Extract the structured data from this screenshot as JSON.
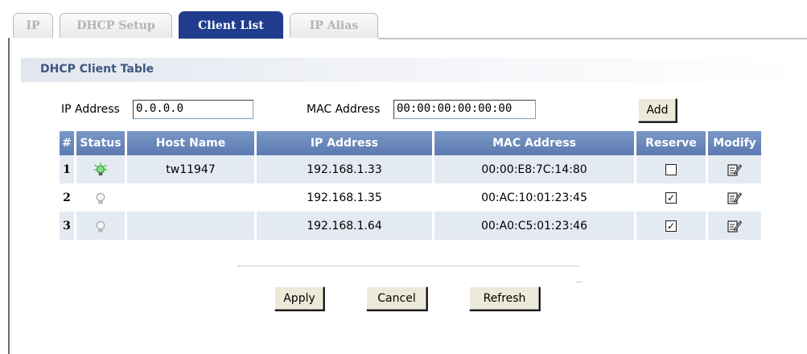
{
  "tabs": [
    {
      "label": "IP",
      "active": false
    },
    {
      "label": "DHCP Setup",
      "active": false
    },
    {
      "label": "Client List",
      "active": true
    },
    {
      "label": "IP Alias",
      "active": false
    }
  ],
  "section": {
    "title": "DHCP Client Table"
  },
  "add_form": {
    "ip_label": "IP Address",
    "ip_value": "0.0.0.0",
    "mac_label": "MAC Address",
    "mac_value": "00:00:00:00:00:00",
    "add_label": "Add"
  },
  "table": {
    "headers": [
      "#",
      "Status",
      "Host Name",
      "IP Address",
      "MAC Address",
      "Reserve",
      "Modify"
    ],
    "rows": [
      {
        "num": "1",
        "status": "active",
        "host": "tw11947",
        "ip": "192.168.1.33",
        "mac": "00:00:E8:7C:14:80",
        "reserve": false
      },
      {
        "num": "2",
        "status": "inactive",
        "host": "",
        "ip": "192.168.1.35",
        "mac": "00:AC:10:01:23:45",
        "reserve": true
      },
      {
        "num": "3",
        "status": "inactive",
        "host": "",
        "ip": "192.168.1.64",
        "mac": "00:A0:C5:01:23:46",
        "reserve": true
      }
    ]
  },
  "buttons": {
    "apply": "Apply",
    "cancel": "Cancel",
    "refresh": "Refresh"
  },
  "colors": {
    "tab_active": "#1f3d8c",
    "header": "#6583b7",
    "row_alt": "#e4eaf2",
    "section_title": "#3e5680",
    "bulb_on": "#2fbf2f"
  }
}
